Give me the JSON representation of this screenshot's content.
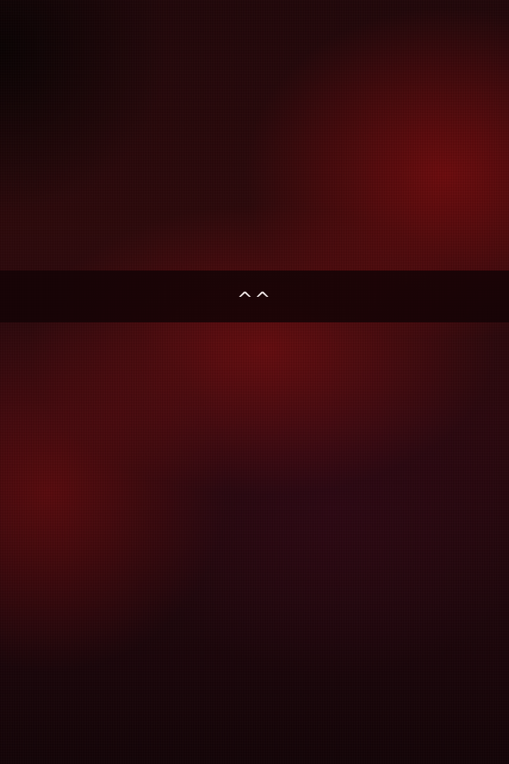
{
  "swipe_bar": {
    "label": "^^",
    "icon": "double-caret-up-icon"
  },
  "colors": {
    "background_dark": "#1a0508",
    "background_red": "#780a0c",
    "band": "#140306",
    "label": "#f2eaea"
  }
}
